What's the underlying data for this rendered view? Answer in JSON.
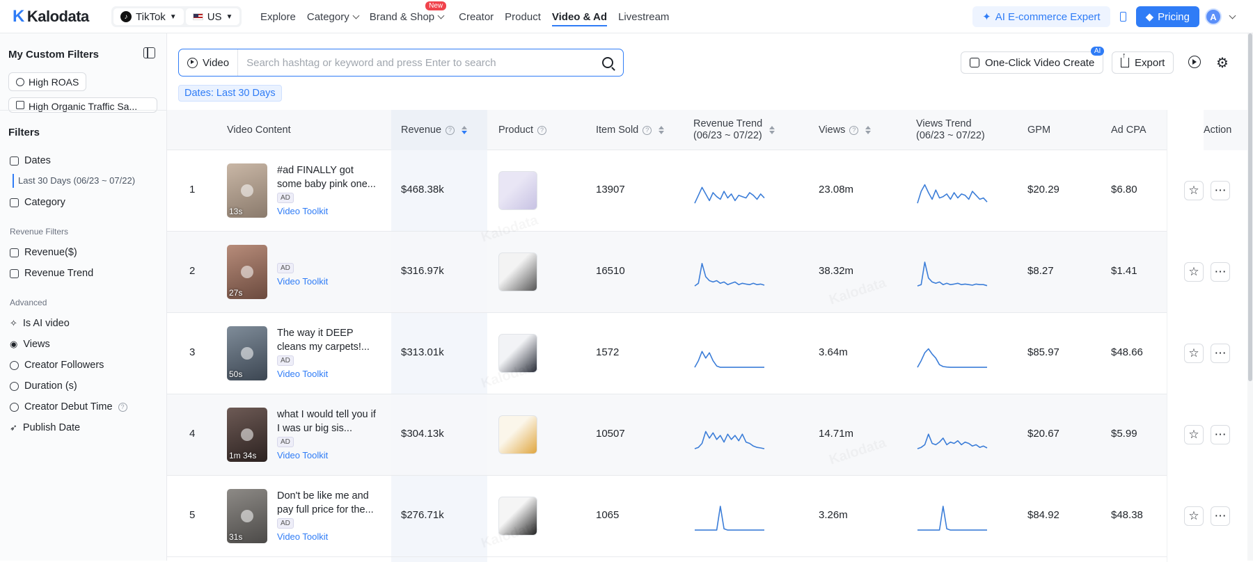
{
  "app": {
    "brand": "Kalodata"
  },
  "platform": {
    "name": "TikTok",
    "region": "US"
  },
  "nav": {
    "items": [
      "Explore",
      "Category",
      "Brand & Shop",
      "Creator",
      "Product",
      "Video & Ad",
      "Livestream"
    ],
    "new_badge": "New",
    "active": "Video & Ad"
  },
  "header_right": {
    "ai_expert": "AI E-commerce Expert",
    "pricing": "Pricing",
    "avatar_initial": "A"
  },
  "sidebar": {
    "title": "My Custom Filters",
    "custom_filters": [
      "High ROAS",
      "High Organic Traffic Sa..."
    ],
    "filters_title": "Filters",
    "dates_label": "Dates",
    "dates_value": "Last 30 Days (06/23 ~ 07/22)",
    "category_label": "Category",
    "revenue_filters_title": "Revenue Filters",
    "revenue_items": [
      "Revenue($)",
      "Revenue Trend"
    ],
    "advanced_title": "Advanced",
    "advanced_items": [
      "Is AI video",
      "Views",
      "Creator Followers",
      "Duration (s)",
      "Creator Debut Time",
      "Publish Date"
    ]
  },
  "search": {
    "type": "Video",
    "placeholder": "Search hashtag or keyword and press Enter to search"
  },
  "date_tag": "Dates: Last 30 Days",
  "toolbar": {
    "one_click": "One-Click Video Create",
    "ai_badge": "AI",
    "export": "Export"
  },
  "columns": {
    "video_content": "Video Content",
    "revenue": "Revenue",
    "product": "Product",
    "item_sold": "Item Sold",
    "revenue_trend": "Revenue Trend",
    "revenue_trend_range": "(06/23 ~ 07/22)",
    "views": "Views",
    "views_trend": "Views Trend",
    "views_trend_range": "(06/23 ~ 07/22)",
    "gpm": "GPM",
    "ad_cpa": "Ad CPA",
    "action": "Action"
  },
  "rows": [
    {
      "rank": "1",
      "duration": "13s",
      "title": "#ad FINALLY got some baby pink one...",
      "ad": "AD",
      "toolkit": "Video Toolkit",
      "revenue": "$468.38k",
      "item_sold": "13907",
      "views": "23.08m",
      "gpm": "$20.29",
      "ad_cpa": "$6.80",
      "revenue_trend": [
        10,
        40,
        70,
        45,
        20,
        50,
        35,
        25,
        55,
        30,
        45,
        20,
        40,
        35,
        30,
        50,
        40,
        25,
        45,
        30
      ],
      "views_trend": [
        10,
        55,
        80,
        50,
        25,
        60,
        30,
        35,
        45,
        25,
        50,
        30,
        45,
        40,
        25,
        55,
        40,
        25,
        30,
        15
      ]
    },
    {
      "rank": "2",
      "duration": "27s",
      "title": "",
      "ad": "AD",
      "toolkit": "Video Toolkit",
      "revenue": "$316.97k",
      "item_sold": "16510",
      "views": "38.32m",
      "gpm": "$8.27",
      "ad_cpa": "$1.41",
      "revenue_trend": [
        5,
        15,
        90,
        40,
        25,
        20,
        25,
        15,
        20,
        10,
        15,
        20,
        10,
        15,
        12,
        10,
        15,
        10,
        12,
        8
      ],
      "views_trend": [
        5,
        10,
        95,
        35,
        20,
        15,
        20,
        10,
        15,
        10,
        12,
        15,
        10,
        12,
        10,
        8,
        12,
        10,
        10,
        6
      ]
    },
    {
      "rank": "3",
      "duration": "50s",
      "title": "The way it DEEP cleans my carpets!...",
      "ad": "AD",
      "toolkit": "Video Toolkit",
      "revenue": "$313.01k",
      "item_sold": "1572",
      "views": "3.64m",
      "gpm": "$85.97",
      "ad_cpa": "$48.66",
      "revenue_trend": [
        5,
        30,
        65,
        40,
        60,
        30,
        10,
        5,
        5,
        5,
        5,
        5,
        5,
        5,
        5,
        5,
        5,
        5,
        5,
        5
      ],
      "views_trend": [
        5,
        30,
        60,
        75,
        55,
        40,
        15,
        8,
        6,
        5,
        5,
        5,
        5,
        5,
        5,
        5,
        5,
        5,
        5,
        5
      ]
    },
    {
      "rank": "4",
      "duration": "1m 34s",
      "title": "what I would tell you if I was ur big sis...",
      "ad": "AD",
      "toolkit": "Video Toolkit",
      "revenue": "$304.13k",
      "item_sold": "10507",
      "views": "14.71m",
      "gpm": "$20.67",
      "ad_cpa": "$5.99",
      "revenue_trend": [
        5,
        10,
        25,
        70,
        45,
        65,
        40,
        55,
        30,
        60,
        40,
        55,
        35,
        60,
        30,
        25,
        15,
        10,
        8,
        5
      ],
      "views_trend": [
        5,
        10,
        20,
        60,
        25,
        20,
        30,
        45,
        20,
        30,
        25,
        35,
        20,
        30,
        25,
        15,
        20,
        10,
        15,
        8
      ]
    },
    {
      "rank": "5",
      "duration": "31s",
      "title": "Don't be like me and pay full price for the...",
      "ad": "AD",
      "toolkit": "Video Toolkit",
      "revenue": "$276.71k",
      "item_sold": "1065",
      "views": "3.26m",
      "gpm": "$84.92",
      "ad_cpa": "$48.38",
      "revenue_trend": [
        5,
        5,
        5,
        5,
        5,
        5,
        5,
        95,
        10,
        5,
        5,
        5,
        5,
        5,
        5,
        5,
        5,
        5,
        5,
        5
      ],
      "views_trend": [
        5,
        5,
        5,
        5,
        5,
        5,
        5,
        95,
        10,
        5,
        5,
        5,
        5,
        5,
        5,
        5,
        5,
        5,
        5,
        5
      ]
    }
  ],
  "colors": {
    "accent": "#2f7cf6",
    "sparkline": "#3b7dd8"
  }
}
